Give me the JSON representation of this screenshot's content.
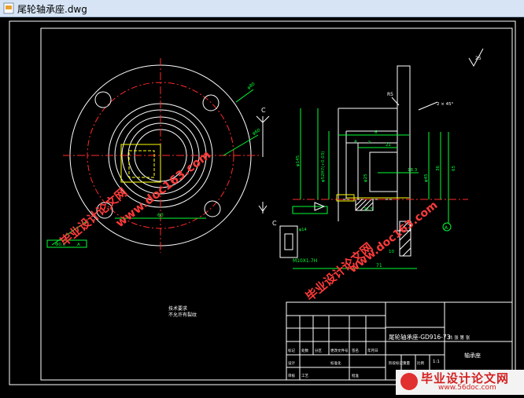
{
  "window": {
    "title": "尾轮轴承座.dwg",
    "icon": "dwg-file-icon"
  },
  "colors": {
    "background": "#000000",
    "lines": "#ffffff",
    "center_lines": "#ff2a2a",
    "dimensions": "#00ff33",
    "hidden_lines": "#ffff00",
    "titlebar": "#d6e4f5"
  },
  "drawing": {
    "tech_req_title": "技术要求",
    "tech_req_line": "不允许有裂纹",
    "surface_finish": "25",
    "section_label": "C",
    "view_label": "C",
    "datum_label": "A",
    "dims": {
      "outer_phi": "φ80",
      "bolt_phi": "φ60",
      "dim_60": "60",
      "tol_a": "Φ0.6",
      "tol_b": "A",
      "R5": "R5",
      "dim_2x45": "2 × 45°",
      "dim_6": "6",
      "dim_21": "21",
      "dim_4": "4",
      "dim_s": "s",
      "dim_40": "40",
      "dim_18_3": "18.3",
      "dim_27_5": "27.5",
      "dim_10": "10",
      "dim_71": "71",
      "d_left": "φ145",
      "d_inner": "φ25",
      "d_45": "φ45",
      "bearing_fit": "φ52H7(+0.03)",
      "thread": "M10X1-7H",
      "ratio_36": "36",
      "ratio_65": "65",
      "c_dim": "φ14"
    }
  },
  "title_block": {
    "part_code": "尾轮轴承座-GD916-73",
    "part_name": "轴承座",
    "scale": "1:1",
    "sheet": "共 张 第 张",
    "rows": [
      "标记",
      "处数",
      "分区",
      "更改文件号",
      "签名",
      "年月日"
    ],
    "rows2": [
      "设计",
      "标准化",
      "阶段标记",
      "重量",
      "比例"
    ],
    "design": "设计",
    "check": "审核",
    "process": "工艺",
    "approve": "批准"
  },
  "watermarks": {
    "cn": "毕业设计论文网",
    "url": "www.doc163.com",
    "banner_cn": "毕业设计论文网",
    "banner_url": "www.56doc.com"
  }
}
